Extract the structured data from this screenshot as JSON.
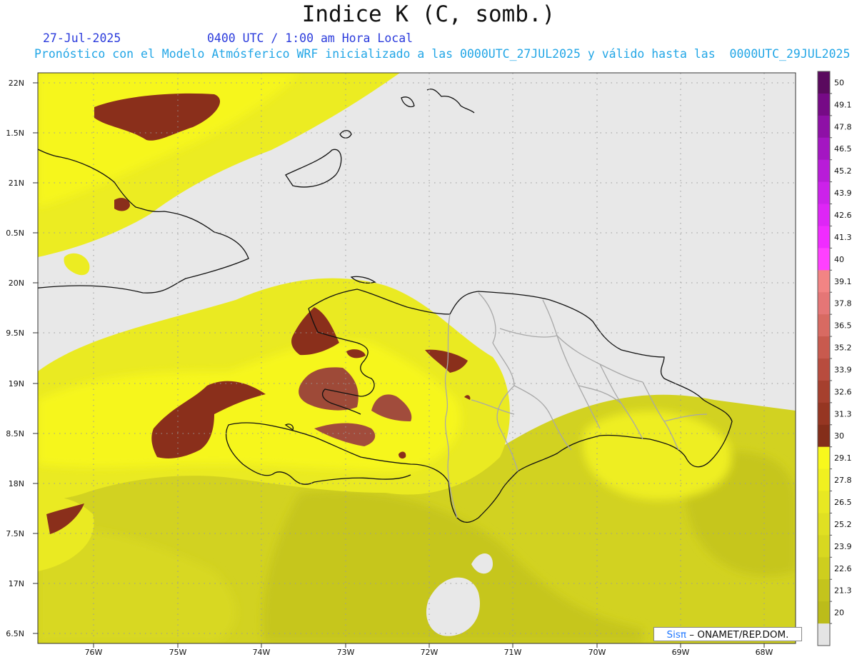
{
  "title": "Indice K (C, somb.)",
  "header": {
    "date": "27-Jul-2025",
    "time": "0400 UTC / 1:00 am Hora Local",
    "subtitle": "Pronóstico con el Modelo Atmósferico WRF inicializado a las 0000UTC_27JUL2025 y válido hasta las  0000UTC_29JUL2025"
  },
  "map": {
    "lat_labels": [
      "22N",
      "1.5N",
      "21N",
      "0.5N",
      "20N",
      "9.5N",
      "19N",
      "8.5N",
      "18N",
      "7.5N",
      "17N",
      "6.5N"
    ],
    "lon_labels": [
      "76W",
      "75W",
      "74W",
      "73W",
      "72W",
      "71W",
      "70W",
      "69W",
      "68W"
    ],
    "land_color": "#e8e8e8"
  },
  "colorbar": {
    "labels": [
      "50",
      "49.1",
      "47.8",
      "46.5",
      "45.2",
      "43.9",
      "42.6",
      "41.3",
      "40",
      "39.1",
      "37.8",
      "36.5",
      "35.2",
      "33.9",
      "32.6",
      "31.3",
      "30",
      "29.1",
      "27.8",
      "26.5",
      "25.2",
      "23.9",
      "22.6",
      "21.3",
      "20"
    ],
    "colors": [
      "#5a0a5e",
      "#760a86",
      "#8e10a6",
      "#a416c2",
      "#b81cd8",
      "#cc22ea",
      "#de26f6",
      "#f02cff",
      "#ff40ff",
      "#f28484",
      "#e57676",
      "#d86a62",
      "#c85a4e",
      "#b84c3e",
      "#a6402e",
      "#963622",
      "#842e1a",
      "#f8f81c",
      "#f0f020",
      "#e8e822",
      "#e0e022",
      "#d8d820",
      "#cece1e",
      "#c4c41c",
      "#bcbc1a",
      "#e4e4e4"
    ]
  },
  "credit": {
    "brand": "Sisπ",
    "text": " – ONAMET/REP.DOM."
  }
}
